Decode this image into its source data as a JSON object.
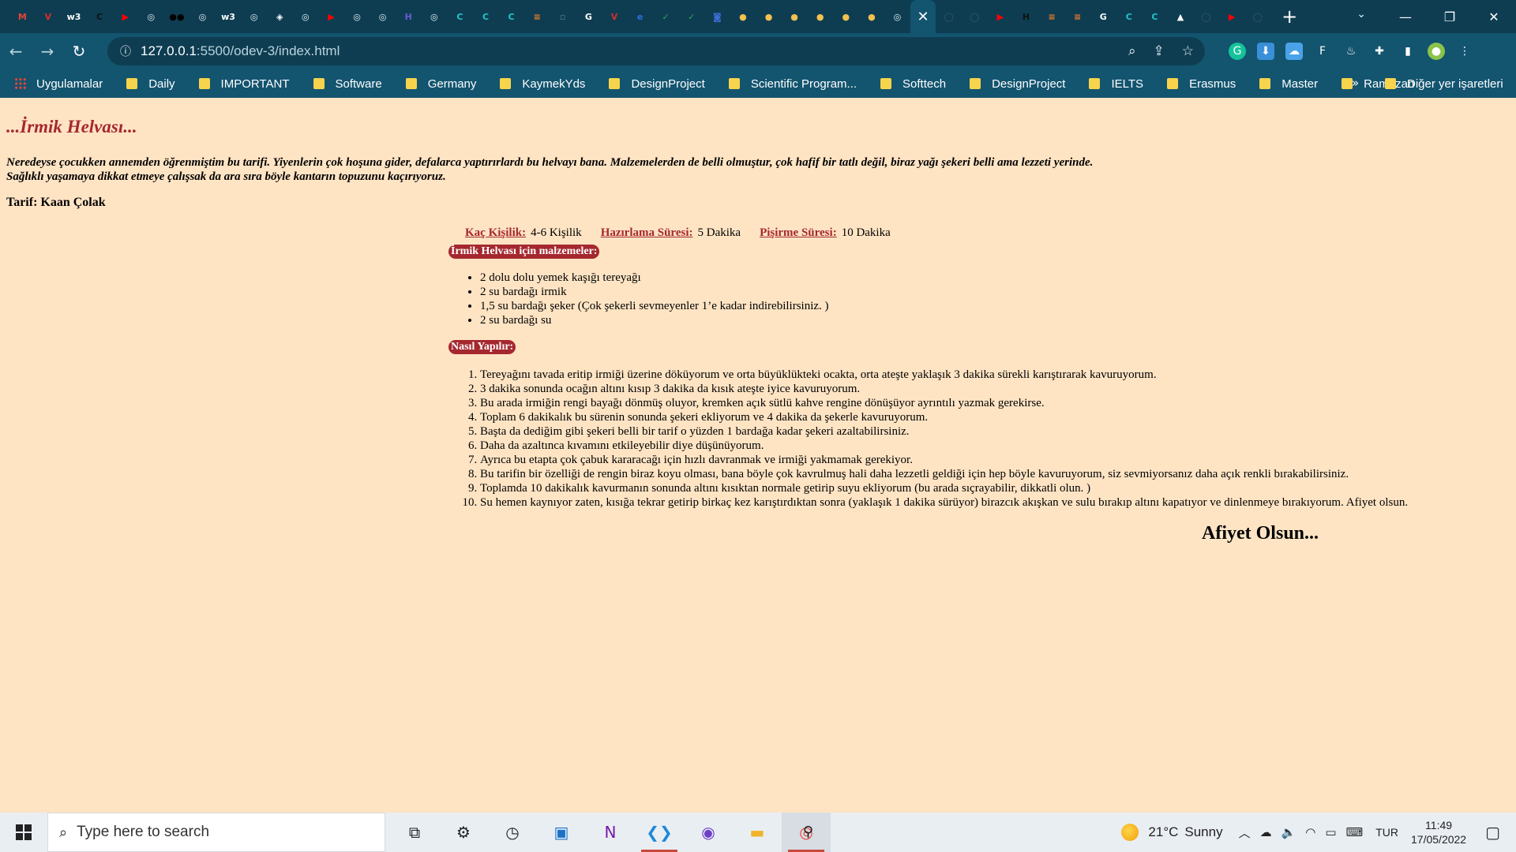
{
  "browser": {
    "tabs": [
      {
        "icon": "gmail-icon",
        "glyph": "M",
        "color": "#ea4335"
      },
      {
        "icon": "vivaldi-icon",
        "glyph": "V",
        "color": "#d62d2d"
      },
      {
        "icon": "w3schools-icon",
        "glyph": "w3",
        "color": "#ffffff"
      },
      {
        "icon": "codecademy-icon",
        "glyph": "C",
        "color": "#111111"
      },
      {
        "icon": "youtube-icon",
        "glyph": "▶",
        "color": "#ff0000"
      },
      {
        "icon": "globe-icon",
        "glyph": "◎",
        "color": "#e6f0f4"
      },
      {
        "icon": "medium-icon",
        "glyph": "●●",
        "color": "#000000"
      },
      {
        "icon": "globe-icon",
        "glyph": "◎",
        "color": "#e6f0f4"
      },
      {
        "icon": "w3schools-icon",
        "glyph": "w3",
        "color": "#ffffff"
      },
      {
        "icon": "globe-icon",
        "glyph": "◎",
        "color": "#e6f0f4"
      },
      {
        "icon": "codepen-icon",
        "glyph": "◈",
        "color": "#ffffff"
      },
      {
        "icon": "globe-icon",
        "glyph": "◎",
        "color": "#e6f0f4"
      },
      {
        "icon": "youtube-icon",
        "glyph": "▶",
        "color": "#ff0000"
      },
      {
        "icon": "globe-icon",
        "glyph": "◎",
        "color": "#e6f0f4"
      },
      {
        "icon": "globe-icon",
        "glyph": "◎",
        "color": "#e6f0f4"
      },
      {
        "icon": "hackerrank-icon",
        "glyph": "H",
        "color": "#6b5bd6"
      },
      {
        "icon": "globe-icon",
        "glyph": "◎",
        "color": "#e6f0f4"
      },
      {
        "icon": "codewars-icon",
        "glyph": "C",
        "color": "#1ec7c7"
      },
      {
        "icon": "codewars-icon",
        "glyph": "C",
        "color": "#1ec7c7"
      },
      {
        "icon": "codewars-icon",
        "glyph": "C",
        "color": "#1ec7c7"
      },
      {
        "icon": "stack-icon",
        "glyph": "≡",
        "color": "#f48024"
      },
      {
        "icon": "page-icon",
        "glyph": "▫",
        "color": "#5b7f8d"
      },
      {
        "icon": "google-icon",
        "glyph": "G",
        "color": "#ffffff"
      },
      {
        "icon": "vivaldi-icon",
        "glyph": "V",
        "color": "#d62d2d"
      },
      {
        "icon": "elearning-icon",
        "glyph": "e",
        "color": "#2a6fdb"
      },
      {
        "icon": "check-icon",
        "glyph": "✓",
        "color": "#34a853"
      },
      {
        "icon": "check-icon",
        "glyph": "✓",
        "color": "#34a853"
      },
      {
        "icon": "shield-icon",
        "glyph": "◙",
        "color": "#3b6fd6"
      },
      {
        "icon": "dot-icon",
        "glyph": "●",
        "color": "#f2c14e"
      },
      {
        "icon": "dot-icon",
        "glyph": "●",
        "color": "#f2c14e"
      },
      {
        "icon": "dot-icon",
        "glyph": "●",
        "color": "#f2c14e"
      },
      {
        "icon": "dot-icon",
        "glyph": "●",
        "color": "#f2c14e"
      },
      {
        "icon": "dot-icon",
        "glyph": "●",
        "color": "#f2c14e"
      },
      {
        "icon": "dot-icon",
        "glyph": "●",
        "color": "#f2c14e"
      },
      {
        "icon": "globe-icon",
        "glyph": "◎",
        "color": "#e6f0f4"
      },
      {
        "icon": "close-icon",
        "glyph": "✕",
        "color": "#ffffff",
        "active": true
      },
      {
        "icon": "github-icon",
        "glyph": "◯",
        "color": "#3b5664"
      },
      {
        "icon": "github-icon",
        "glyph": "◯",
        "color": "#3b5664"
      },
      {
        "icon": "youtube-icon",
        "glyph": "▶",
        "color": "#ff0000"
      },
      {
        "icon": "hackerrank-icon",
        "glyph": "H",
        "color": "#111111"
      },
      {
        "icon": "stack-icon",
        "glyph": "≡",
        "color": "#f48024"
      },
      {
        "icon": "stack-icon",
        "glyph": "≡",
        "color": "#f48024"
      },
      {
        "icon": "google-icon",
        "glyph": "G",
        "color": "#ffffff"
      },
      {
        "icon": "codewars-icon",
        "glyph": "C",
        "color": "#1ec7c7"
      },
      {
        "icon": "codewars-icon",
        "glyph": "C",
        "color": "#1ec7c7"
      },
      {
        "icon": "mountain-icon",
        "glyph": "▲",
        "color": "#ffffff"
      },
      {
        "icon": "github-icon",
        "glyph": "◯",
        "color": "#3b5664"
      },
      {
        "icon": "youtube-icon",
        "glyph": "▶",
        "color": "#ff0000"
      },
      {
        "icon": "github-icon",
        "glyph": "◯",
        "color": "#3b5664"
      }
    ],
    "url_host": "127.0.0.1",
    "url_path": ":5500/odev-3/index.html",
    "bookmarks": [
      "Uygulamalar",
      "Daily",
      "IMPORTANT",
      "Software",
      "Germany",
      "KaymekYds",
      "DesignProject",
      "Scientific Program...",
      "Softtech",
      "DesignProject",
      "IELTS",
      "Erasmus",
      "Master",
      "Ramazan"
    ],
    "bookmarks_more": "»",
    "other_bookmarks": "Diğer yer işaretleri",
    "accent": "#13546f"
  },
  "recipe": {
    "title": "...İrmik Helvası...",
    "intro_line1": "Neredeyse çocukken annemden öğrenmiştim bu tarifi. Yiyenlerin çok hoşuna gider, defalarca yaptırırlardı bu helvayı bana. Malzemelerden de belli olmuştur, çok hafif bir tatlı değil, biraz yağı şekeri belli ama lezzeti yerinde.",
    "intro_line2": "Sağlıklı yaşamaya dikkat etmeye çalışsak da ara sıra böyle kantarın topuzunu kaçırıyoruz.",
    "author_label": "Tarif:",
    "author_name": "Kaan Çolak",
    "info": [
      {
        "label": "Kaç Kişilik:",
        "value": "4-6 Kişilik"
      },
      {
        "label": "Hazırlama Süresi:",
        "value": "5 Dakika"
      },
      {
        "label": "Pişirme Süresi:",
        "value": "10 Dakika"
      }
    ],
    "ingredients_heading": "İrmik Helvası için malzemeler:",
    "ingredients": [
      "2 dolu dolu yemek kaşığı tereyağı",
      "2 su bardağı irmik",
      "1,5 su bardağı şeker (Çok şekerli sevmeyenler 1’e kadar indirebilirsiniz. )",
      "2 su bardağı su"
    ],
    "steps_heading": "Nasıl Yapılır:",
    "steps": [
      "Tereyağını tavada eritip irmiği üzerine döküyorum ve orta büyüklükteki ocakta, orta ateşte yaklaşık 3 dakika sürekli karıştırarak kavuruyorum.",
      "3 dakika sonunda ocağın altını kısıp 3 dakika da kısık ateşte iyice kavuruyorum.",
      "Bu arada irmiğin rengi bayağı dönmüş oluyor, kremken açık sütlü kahve rengine dönüşüyor ayrıntılı yazmak gerekirse.",
      "Toplam 6 dakikalık bu sürenin sonunda şekeri ekliyorum ve 4 dakika da şekerle kavuruyorum.",
      "Başta da dediğim gibi şekeri belli bir tarif o yüzden 1 bardağa kadar şekeri azaltabilirsiniz.",
      "Daha da azaltınca kıvamını etkileyebilir diye düşünüyorum.",
      "Ayrıca bu etapta çok çabuk kararacağı için hızlı davranmak ve irmiği yakmamak gerekiyor.",
      "Bu tarifin bir özelliği de rengin biraz koyu olması, bana böyle çok kavrulmuş hali daha lezzetli geldiği için hep böyle kavuruyorum, siz sevmiyorsanız daha açık renkli bırakabilirsiniz.",
      "Toplamda 10 dakikalık kavurmanın sonunda altını kısıktan normale getirip suyu ekliyorum (bu arada sıçrayabilir, dikkatli olun. )",
      "Su hemen kaynıyor zaten, kısığa tekrar getirip birkaç kez karıştırdıktan sonra (yaklaşık 1 dakika sürüyor) birazcık akışkan ve sulu bırakıp altını kapatıyor ve dinlenmeye bırakıyorum. Afiyet olsun."
    ],
    "closing": "Afiyet Olsun...",
    "accent_color": "#a5282f",
    "background_color": "#ffe4c4"
  },
  "taskbar": {
    "search_placeholder": "Type here to search",
    "apps": [
      {
        "name": "task-view-icon",
        "glyph": "⧉",
        "color": "#222222",
        "running": false
      },
      {
        "name": "settings-icon",
        "glyph": "⚙",
        "color": "#222222",
        "running": false
      },
      {
        "name": "clock-app-icon",
        "glyph": "◷",
        "color": "#222222",
        "running": false
      },
      {
        "name": "remote-desktop-icon",
        "glyph": "▣",
        "color": "#1a73c8",
        "running": false
      },
      {
        "name": "onenote-icon",
        "glyph": "N",
        "color": "#7719aa",
        "running": false
      },
      {
        "name": "vscode-icon",
        "glyph": "❮❯",
        "color": "#1f88d8",
        "running": true
      },
      {
        "name": "github-desktop-icon",
        "glyph": "◉",
        "color": "#6e40c9",
        "running": false
      },
      {
        "name": "file-explorer-icon",
        "glyph": "▬",
        "color": "#f0b429",
        "running": false
      },
      {
        "name": "chrome-icon",
        "glyph": "◎",
        "color": "#ea4335",
        "running": true,
        "active": true
      }
    ],
    "weather_temp": "21°C",
    "weather_desc": "Sunny",
    "language": "TUR",
    "time": "11:49",
    "date": "17/05/2022"
  }
}
